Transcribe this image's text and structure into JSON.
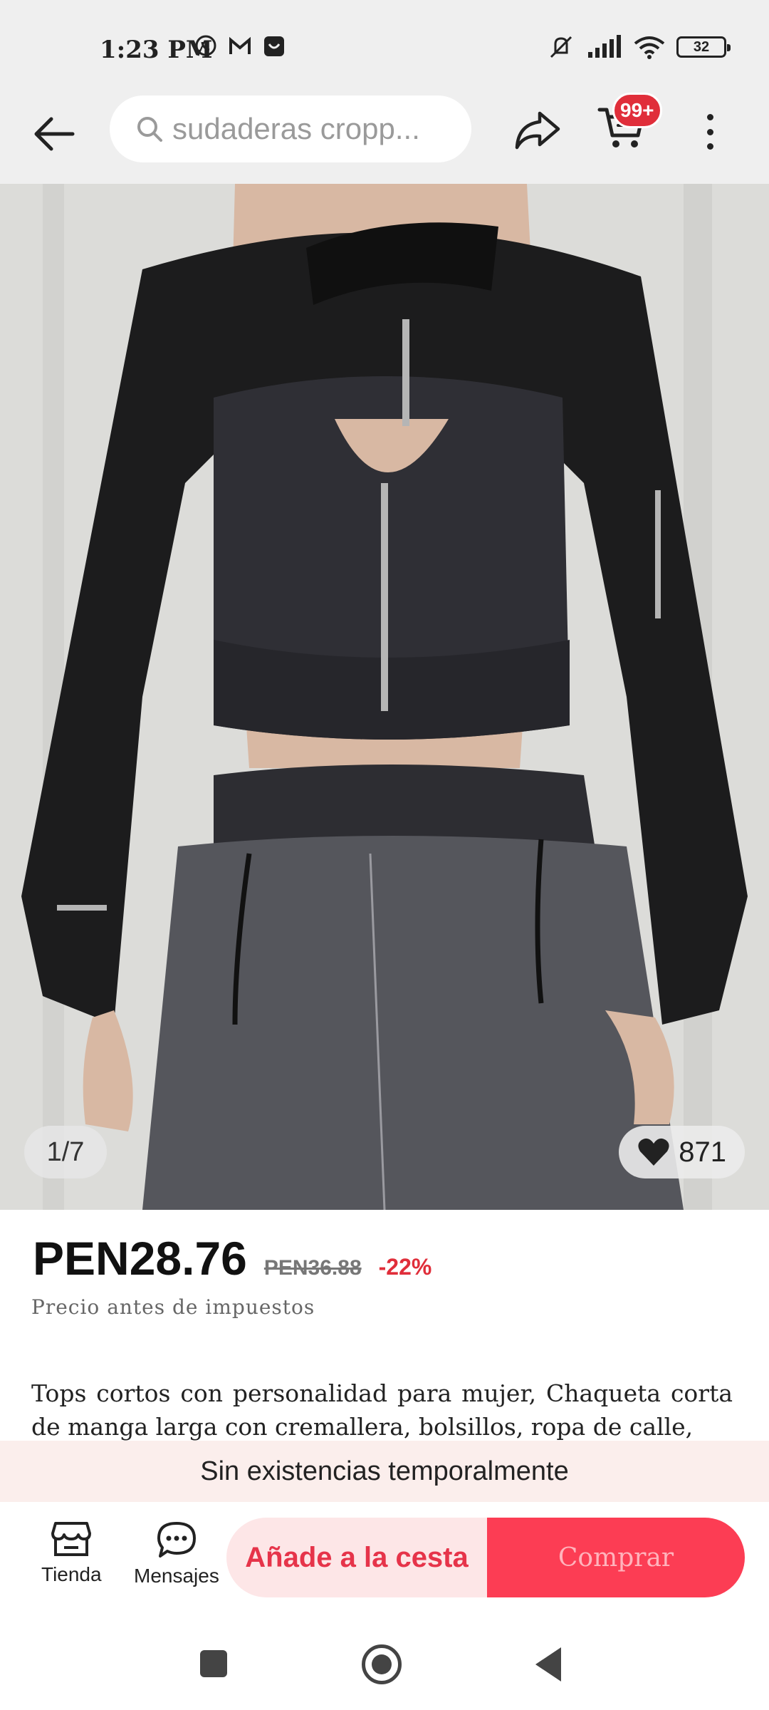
{
  "status_bar": {
    "time": "1:23 PM",
    "battery": "32",
    "icons": [
      "whatsapp-icon",
      "gmail-icon",
      "app-icon",
      "mute-icon",
      "signal-icon",
      "wifi-icon",
      "battery-icon"
    ]
  },
  "header": {
    "search_text": "sudaderas cropp...",
    "cart_badge": "99+"
  },
  "gallery": {
    "counter": "1/7",
    "likes": "871"
  },
  "price": {
    "current": "PEN28.76",
    "original": "PEN36.88",
    "discount": "-22%",
    "tax_note": "Precio antes de impuestos"
  },
  "description": "Tops cortos con personalidad para mujer, Chaqueta corta de manga larga con cremallera, bolsillos, ropa de calle,",
  "stock_banner": "Sin existencias temporalmente",
  "bottom_bar": {
    "store_label": "Tienda",
    "messages_label": "Mensajes",
    "add_to_cart": "Añade a la cesta",
    "buy": "Comprar"
  },
  "colors": {
    "accent": "#fc3d54",
    "badge": "#e02e3a",
    "discount": "#e02e3a"
  }
}
